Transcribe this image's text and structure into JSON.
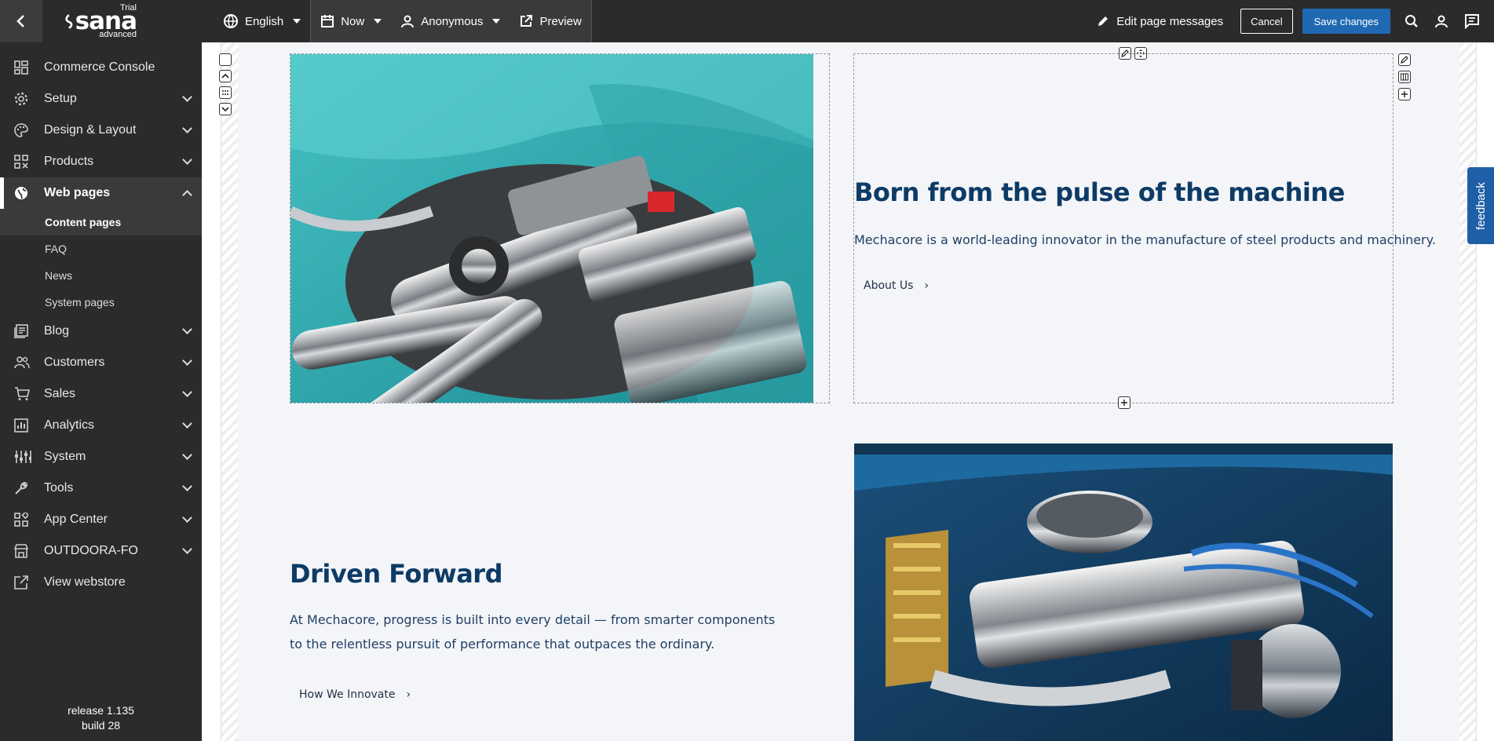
{
  "topbar": {
    "logo_text": "sana",
    "trial_label": "Trial",
    "edition_label": "advanced",
    "language": "English",
    "time": "Now",
    "visitor": "Anonymous",
    "preview": "Preview",
    "edit_messages": "Edit page messages",
    "cancel": "Cancel",
    "save": "Save changes"
  },
  "sidebar": {
    "items": [
      {
        "label": "Commerce Console",
        "icon": "dashboard-icon"
      },
      {
        "label": "Setup",
        "icon": "gear-icon"
      },
      {
        "label": "Design & Layout",
        "icon": "palette-icon"
      },
      {
        "label": "Products",
        "icon": "grid-icon"
      },
      {
        "label": "Web pages",
        "icon": "globe-icon"
      },
      {
        "label": "Blog",
        "icon": "blog-icon"
      },
      {
        "label": "Customers",
        "icon": "users-icon"
      },
      {
        "label": "Sales",
        "icon": "cart-icon"
      },
      {
        "label": "Analytics",
        "icon": "bar-chart-icon"
      },
      {
        "label": "System",
        "icon": "sliders-icon"
      },
      {
        "label": "Tools",
        "icon": "wrench-icon"
      },
      {
        "label": "App Center",
        "icon": "apps-icon"
      },
      {
        "label": "OUTDOORA-FO",
        "icon": "store-icon"
      },
      {
        "label": "View webstore",
        "icon": "external-link-icon"
      }
    ],
    "subitems": [
      {
        "label": "Content pages"
      },
      {
        "label": "FAQ"
      },
      {
        "label": "News"
      },
      {
        "label": "System pages"
      }
    ],
    "release": "release 1.135",
    "build": "build 28"
  },
  "content": {
    "block1": {
      "heading": "Born from the pulse of the machine",
      "text": "Mechacore is a world-leading innovator in the manufacture of steel products and machinery.",
      "link": "About Us"
    },
    "block2": {
      "heading": "Driven Forward",
      "text": "At Mechacore, progress is built into every detail — from smarter components to the relentless pursuit of performance that outpaces the ordinary.",
      "link": "How We Innovate"
    }
  },
  "feedback": "feedback",
  "colors": {
    "accent": "#1f69b3",
    "heading": "#0d3b66",
    "topbar": "#2b2b2b"
  }
}
